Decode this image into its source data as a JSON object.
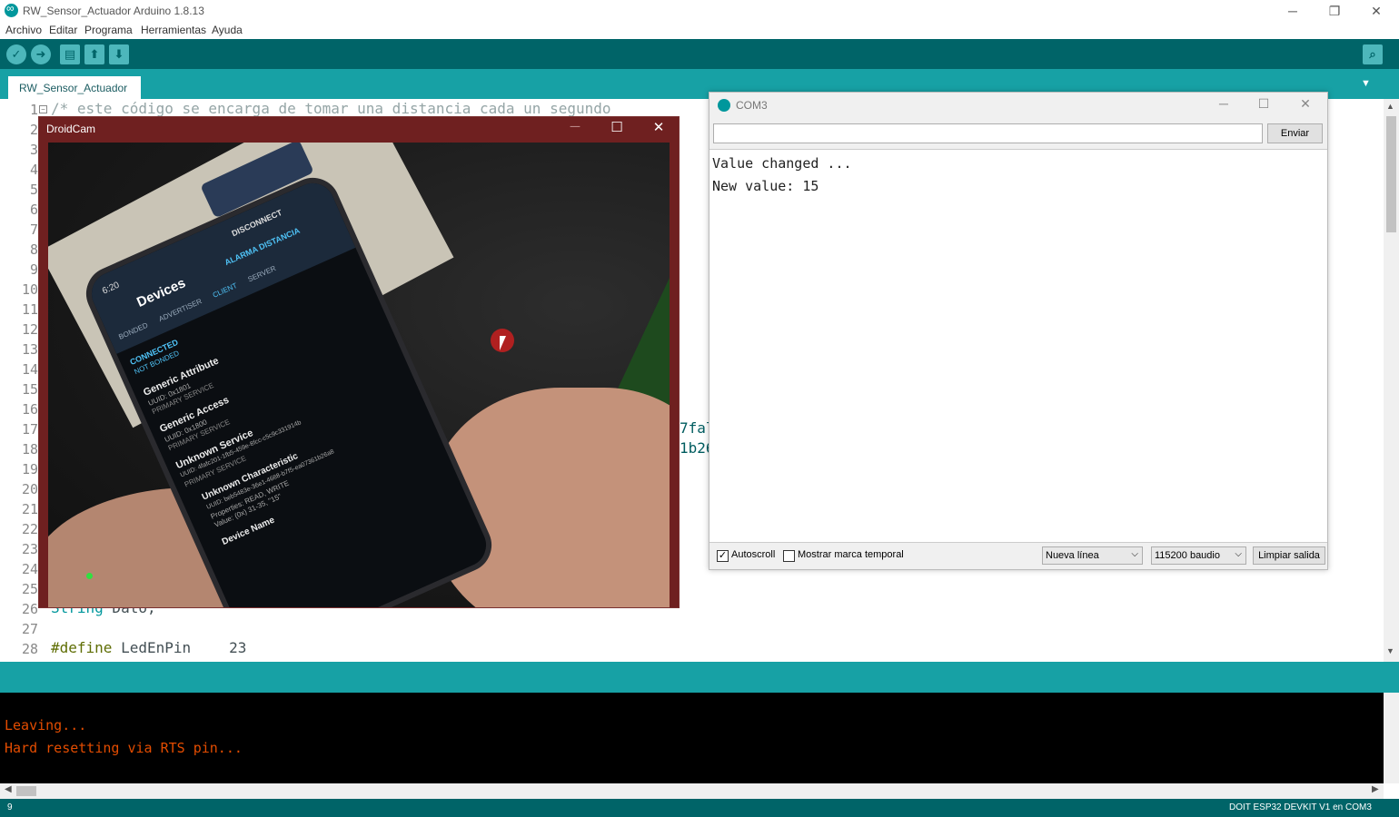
{
  "window": {
    "title": "RW_Sensor_Actuador Arduino 1.8.13",
    "minimize": "─",
    "restore": "❐",
    "close": "✕"
  },
  "menu": [
    "Archivo",
    "Editar",
    "Programa",
    "Herramientas",
    "Ayuda"
  ],
  "toolbar": {
    "verify_glyph": "✓",
    "upload_glyph": "➜",
    "new_glyph": "▤",
    "open_glyph": "⬆",
    "save_glyph": "⬇",
    "serial_glyph": "⌕"
  },
  "tab": {
    "label": "RW_Sensor_Actuador",
    "menu_glyph": "▼"
  },
  "editor": {
    "line_numbers": [
      "1",
      "2",
      "3",
      "4",
      "5",
      "6",
      "7",
      "8",
      "9",
      "10",
      "11",
      "12",
      "13",
      "14",
      "15",
      "16",
      "17",
      "18",
      "19",
      "20",
      "21",
      "22",
      "23",
      "24",
      "25",
      "26",
      "27",
      "28"
    ],
    "line1_comment": "/* este código se encarga de tomar una distancia cada un segundo",
    "line17_frag": "7fal",
    "line18_frag": "1b26",
    "line26_type": "String",
    "line26_var": " Dato;",
    "line28_directive": "#define",
    "line28_name": " LedEnPin",
    "line28_value": "23"
  },
  "console": {
    "line1": "Leaving...",
    "line2": "Hard resetting via RTS pin..."
  },
  "footer": {
    "line": "9",
    "board": "DOIT ESP32 DEVKIT V1 en COM3"
  },
  "droidcam": {
    "title": "DroidCam",
    "minimize": "─",
    "maximize": "☐",
    "close": "✕"
  },
  "phone": {
    "time": "6:20",
    "header": "Devices",
    "status_right": "DISCONNECT",
    "alarm": "ALARMA DISTANCIA",
    "tabs": [
      "BONDED",
      "ADVERTISER",
      "CLIENT",
      "SERVER"
    ],
    "connection": "CONNECTED",
    "bond": "NOT BONDED",
    "services": [
      {
        "name": "Generic Attribute",
        "uuid": "UUID: 0x1801",
        "type": "PRIMARY SERVICE"
      },
      {
        "name": "Generic Access",
        "uuid": "UUID: 0x1800",
        "type": "PRIMARY SERVICE"
      },
      {
        "name": "Unknown Service",
        "uuid": "UUID: 4fafc201-1fb5-459e-8fcc-c5c9c331914b",
        "type": "PRIMARY SERVICE"
      }
    ],
    "characteristic": "Unknown Characteristic",
    "char_uuid": "UUID: beb5483e-36e1-4688-b7f5-ea07361b26a8",
    "properties": "Properties: READ, WRITE",
    "value": "Value: (0x) 31-35, \"15\"",
    "device_name": "Device Name"
  },
  "serial": {
    "title": "COM3",
    "minimize": "─",
    "maximize": "☐",
    "close": "✕",
    "input_value": "",
    "send_label": "Enviar",
    "output": [
      "Value changed ...",
      "New value: 15"
    ],
    "autoscroll_label": "Autoscroll",
    "autoscroll_checked": "✓",
    "timestamp_label": "Mostrar marca temporal",
    "line_ending": "Nueva línea",
    "baud": "115200 baudio",
    "clear_label": "Limpiar salida",
    "dropdown_glyph": "⌵"
  }
}
